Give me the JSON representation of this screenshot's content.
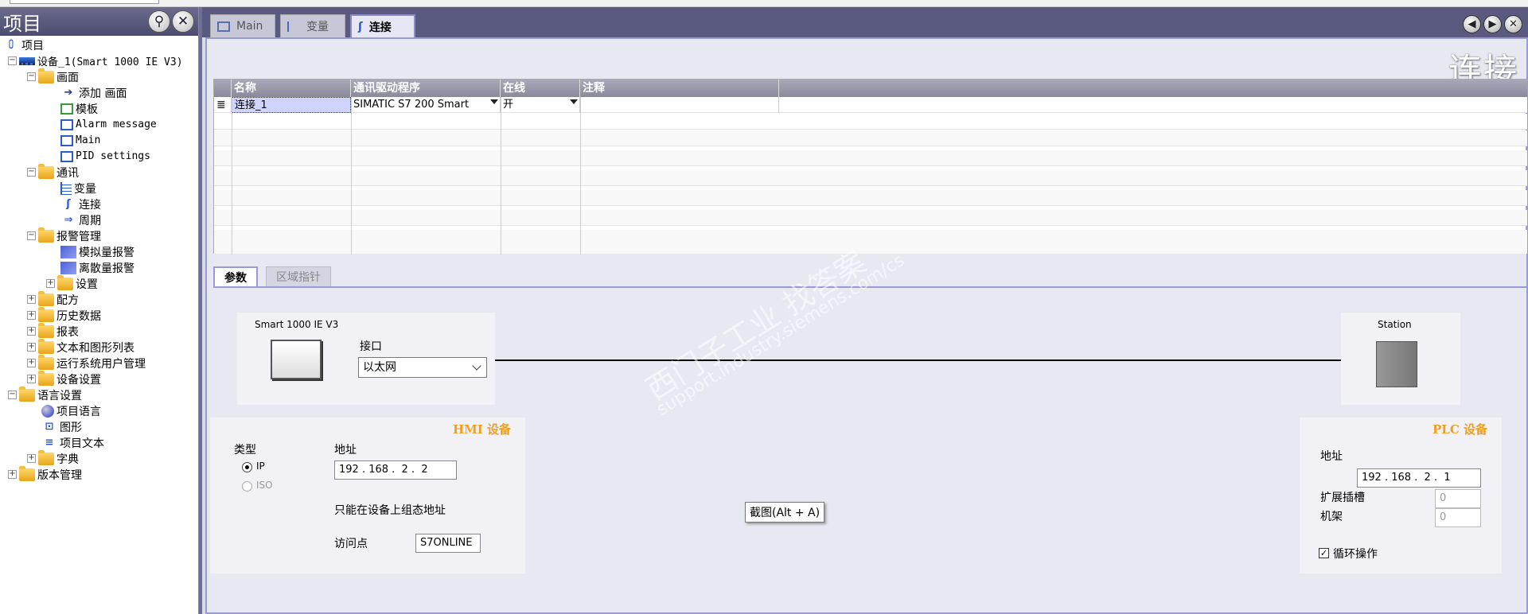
{
  "tree": {
    "title": "项目",
    "items": [
      {
        "label": "项目"
      },
      {
        "label": "设备_1(Smart 1000 IE V3)"
      },
      {
        "label": "画面"
      },
      {
        "label": "添加 画面"
      },
      {
        "label": "模板"
      },
      {
        "label": "Alarm message"
      },
      {
        "label": "Main"
      },
      {
        "label": "PID settings"
      },
      {
        "label": "通讯"
      },
      {
        "label": "变量"
      },
      {
        "label": "连接"
      },
      {
        "label": "周期"
      },
      {
        "label": "报警管理"
      },
      {
        "label": "模拟量报警"
      },
      {
        "label": "离散量报警"
      },
      {
        "label": "设置"
      },
      {
        "label": "配方"
      },
      {
        "label": "历史数据"
      },
      {
        "label": "报表"
      },
      {
        "label": "文本和图形列表"
      },
      {
        "label": "运行系统用户管理"
      },
      {
        "label": "设备设置"
      },
      {
        "label": "语言设置"
      },
      {
        "label": "项目语言"
      },
      {
        "label": "图形"
      },
      {
        "label": "项目文本"
      },
      {
        "label": "字典"
      },
      {
        "label": "版本管理"
      }
    ]
  },
  "tabs": [
    {
      "label": "Main"
    },
    {
      "label": "变量"
    },
    {
      "label": "连接"
    }
  ],
  "editor": {
    "title": "连接",
    "grid": {
      "headers": [
        "名称",
        "通讯驱动程序",
        "在线",
        "注释"
      ],
      "row": {
        "name": "连接_1",
        "driver": "SIMATIC S7 200 Smart",
        "online": "开",
        "comment": ""
      }
    },
    "subtabs": [
      "参数",
      "区域指针"
    ],
    "hmi_device": "Smart 1000 IE V3",
    "interface_label": "接口",
    "interface_value": "以太网",
    "station_label": "Station",
    "hmi": {
      "title": "HMI 设备",
      "type_label": "类型",
      "type_ip": "IP",
      "type_iso": "ISO",
      "address_label": "地址",
      "address_value": "192 . 168 .  2 .  2",
      "note": "只能在设备上组态地址",
      "access_point_label": "访问点",
      "access_point_value": "S7ONLINE"
    },
    "plc": {
      "title": "PLC 设备",
      "address_label": "地址",
      "address_value": "192 . 168 .  2 .  1",
      "slot_label": "扩展插槽",
      "slot_value": "0",
      "rack_label": "机架",
      "rack_value": "0",
      "cyclic_label": "循环操作",
      "cyclic_checked": true
    },
    "tooltip": "截图(Alt + A)"
  },
  "watermark": {
    "cn": "西门子工业   找答案",
    "en": "support.industry.siemens.com/cs"
  }
}
